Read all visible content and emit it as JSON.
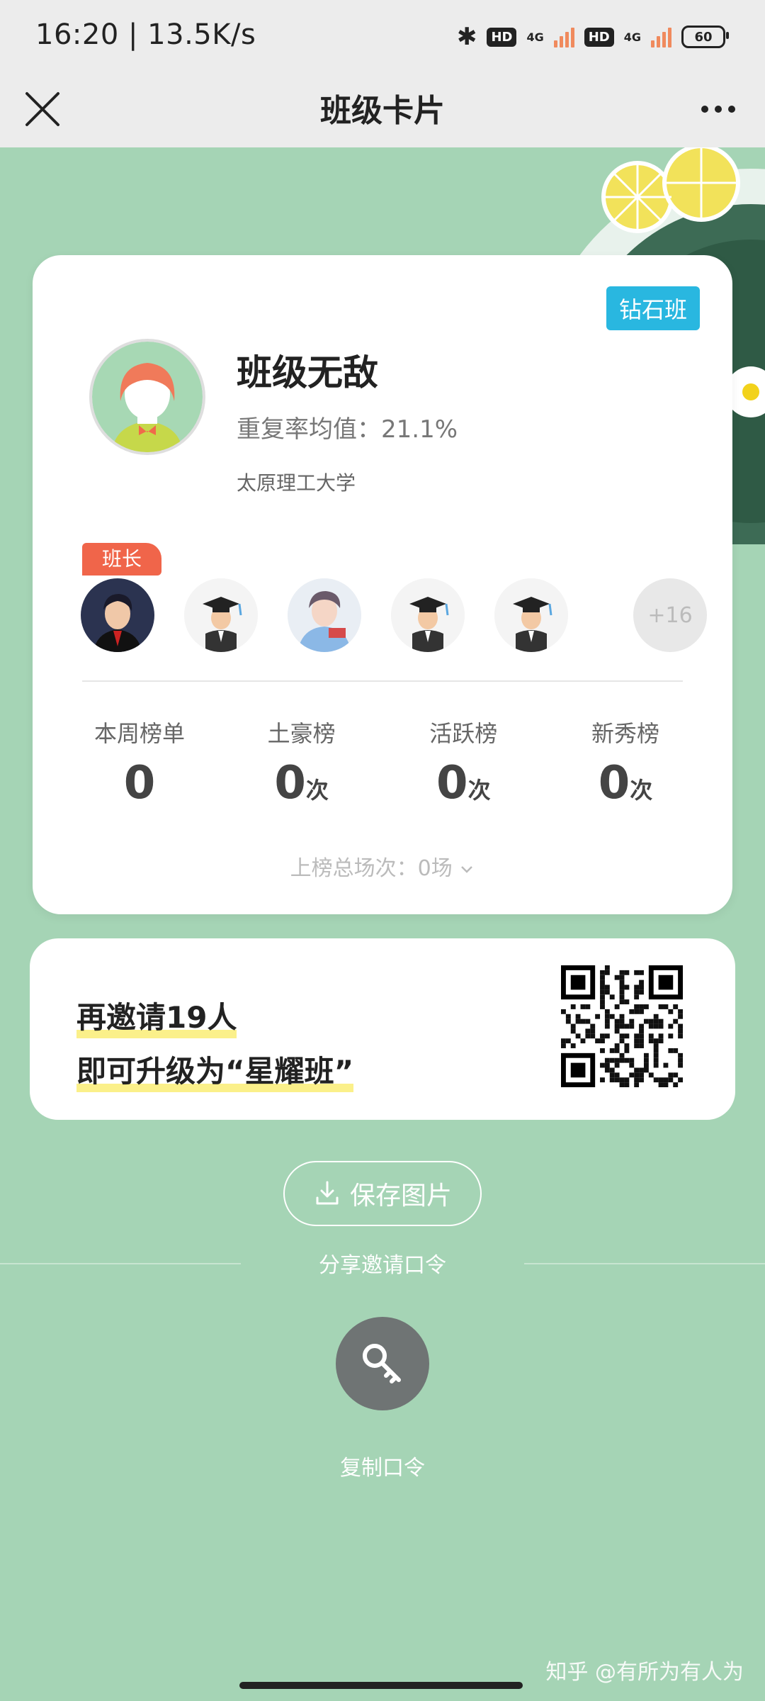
{
  "status_bar": {
    "time": "16:20 | 13.5K/s",
    "hd1": "HD",
    "net1": "4G",
    "hd2": "HD",
    "net2": "4G",
    "battery": "60"
  },
  "nav": {
    "title": "班级卡片"
  },
  "class_card": {
    "tier_badge": "钻石班",
    "name": "班级无敌",
    "repeat_rate_label": "重复率均值：",
    "repeat_rate_value": "21.1%",
    "school": "太原理工大学",
    "monitor_tag": "班长",
    "more_members": "+16",
    "stats": [
      {
        "label": "本周榜单",
        "value": "0",
        "unit": ""
      },
      {
        "label": "土豪榜",
        "value": "0",
        "unit": "次"
      },
      {
        "label": "活跃榜",
        "value": "0",
        "unit": "次"
      },
      {
        "label": "新秀榜",
        "value": "0",
        "unit": "次"
      }
    ],
    "total_rank": "上榜总场次：0场"
  },
  "invite": {
    "line1": "再邀请19人",
    "line2": "即可升级为“星耀班”"
  },
  "actions": {
    "save_image": "保存图片",
    "share_invite": "分享邀请口令",
    "copy_code": "复制口令"
  },
  "watermark": "知乎 @有所为有人为",
  "colors": {
    "background": "#a5d4b5",
    "badge": "#29b7e0",
    "monitor_tag": "#f0654a"
  }
}
